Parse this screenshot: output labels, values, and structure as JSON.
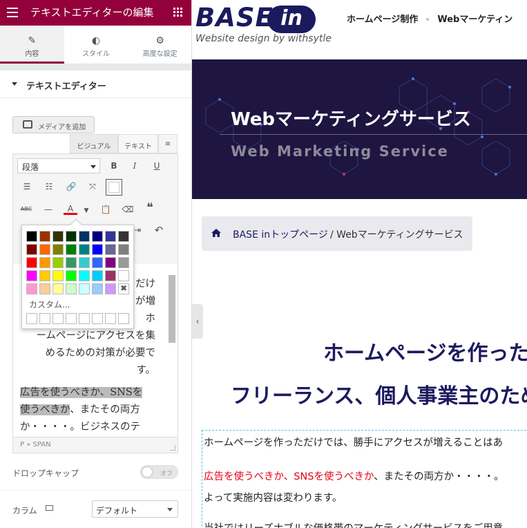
{
  "panel": {
    "title": "テキストエディターの編集",
    "tabs": [
      {
        "label": "内容",
        "icon": "pencil-icon"
      },
      {
        "label": "スタイル",
        "icon": "contrast-icon"
      },
      {
        "label": "高度な設定",
        "icon": "gear-icon"
      }
    ],
    "section_title": "テキストエディター",
    "media_button": "メディアを追加",
    "editor_tabs": {
      "visual": "ビジュアル",
      "text": "テキスト"
    },
    "format_select": "段落",
    "toolbar": {
      "bold": "B",
      "italic": "I",
      "underline": "U",
      "strike": "ABC",
      "text_color": "A",
      "quote": "❝",
      "undo": "↶"
    },
    "custom_label": "カスタム...",
    "content": {
      "p1": "だけ\nが増\nホ\nームページにアクセスを集\nめるための対策が必要で\nす。",
      "p2_hl1": "広告を使うべきか、SNSを",
      "p2_hl2": "使うべきか",
      "p2_rest": "、またその両方\nか・・・・。ビジネスのテ"
    },
    "path": "P » SPAN",
    "dropcap_label": "ドロップキャップ",
    "dropcap_toggle": "オフ",
    "columns_label": "カラム",
    "columns_value": "デフォルト"
  },
  "site": {
    "logo_text": "BASE",
    "logo_badge": "in",
    "logo_sub": "Website design by withsytle",
    "nav": [
      "ホームページ制作",
      "Webマーケティン"
    ],
    "hero_title": "Webマーケティングサービス",
    "hero_sub": "Web Marketing Service",
    "breadcrumb": {
      "home": "BASE inトップページ",
      "sep": "/",
      "current": "Webマーケティングサービス"
    },
    "heading1": "ホームページを作った",
    "heading2": "フリーランス、個人事業主のため",
    "body": {
      "line1": "ホームページを作っただけでは、勝手にアクセスが増えることはあ",
      "line2_red": "広告を使うべきか、SNSを使うべきか",
      "line2_rest": "、またその両方か・・・・。",
      "line3": "よって実施内容は変わります。",
      "line4": "当社ではリーズナブルな価格帯のマーケティングサービスをご用意"
    }
  },
  "colors": {
    "brand": "#93003c",
    "navy": "#1c1a5e",
    "hero_bg": "#1e1540",
    "text_red": "#e60012"
  },
  "palette": [
    "#000000",
    "#993300",
    "#333300",
    "#003300",
    "#003366",
    "#000080",
    "#333399",
    "#333333",
    "#800000",
    "#ff6600",
    "#808000",
    "#008000",
    "#008080",
    "#0000ff",
    "#666699",
    "#808080",
    "#ff0000",
    "#ff9900",
    "#99cc00",
    "#339966",
    "#33cccc",
    "#3366ff",
    "#800080",
    "#999999",
    "#ff00ff",
    "#ffcc00",
    "#ffff00",
    "#00ff00",
    "#00ffff",
    "#00ccff",
    "#993366",
    "#ffffff",
    "#ff99cc",
    "#ffcc99",
    "#ffff99",
    "#ccffcc",
    "#ccffff",
    "#99ccff",
    "#cc99ff",
    "none"
  ]
}
